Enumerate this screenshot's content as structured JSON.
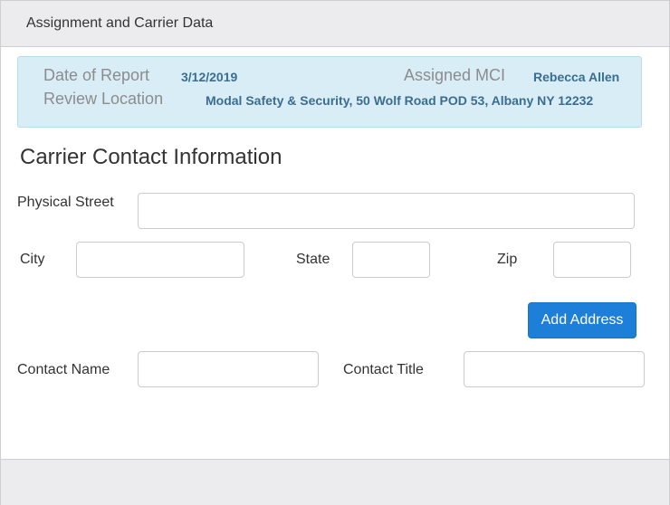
{
  "panel": {
    "title": "Assignment and Carrier Data"
  },
  "report_info": {
    "date_label": "Date of Report",
    "date_value": "3/12/2019",
    "mci_label": "Assigned MCI",
    "mci_value": "Rebecca Allen",
    "location_label": "Review Location",
    "location_value": "Modal Safety & Security, 50 Wolf Road POD 53, Albany NY 12232"
  },
  "carrier_contact": {
    "heading": "Carrier Contact Information",
    "physical_street_label": "Physical Street",
    "physical_street_value": "",
    "city_label": "City",
    "city_value": "",
    "state_label": "State",
    "state_value": "",
    "zip_label": "Zip",
    "zip_value": "",
    "add_address_label": "Add Address",
    "contact_name_label": "Contact Name",
    "contact_name_value": "",
    "contact_title_label": "Contact Title",
    "contact_title_value": ""
  },
  "colors": {
    "header_bg": "#ececee",
    "info_bg": "#d9edf7",
    "info_value": "#3a6d8f",
    "primary_button": "#1e7fd8"
  }
}
